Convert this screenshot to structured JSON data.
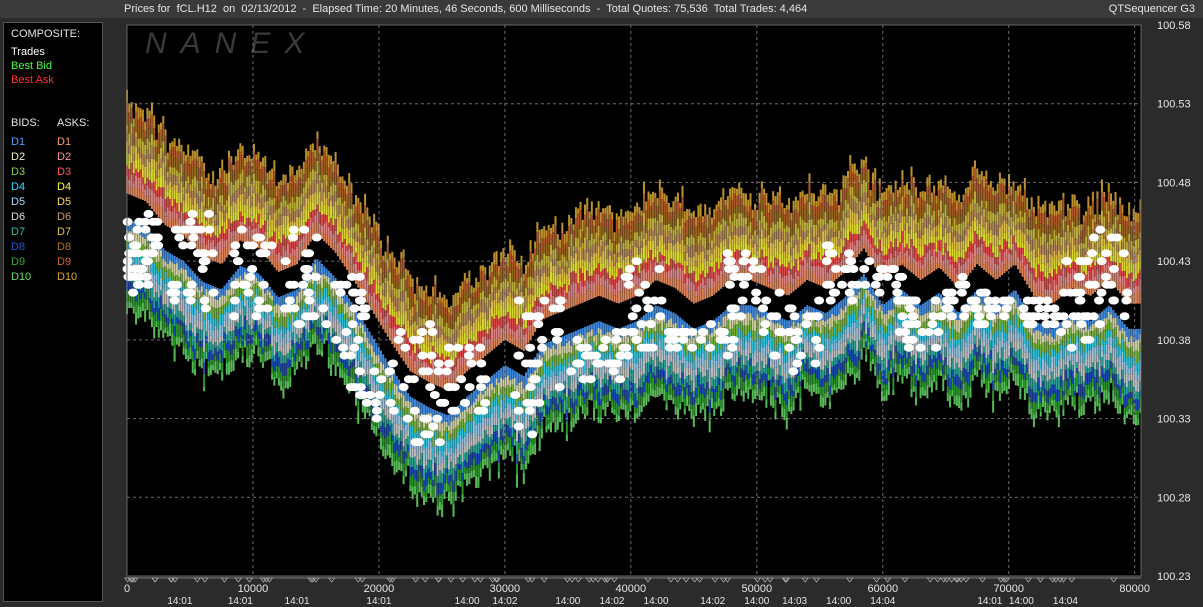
{
  "header": {
    "title": "Prices for  fCL.H12  on  02/13/2012  -  Elapsed Time: 20 Minutes, 46 Seconds, 600 Milliseconds  -  Total Quotes: 75,536  Total Trades: 4,464",
    "app_name": "QTSequencer G3"
  },
  "watermark": "NANEX",
  "legend": {
    "composite_label": "COMPOSITE:",
    "composite_items": [
      {
        "label": "Trades",
        "color": "#ffffff"
      },
      {
        "label": "Best Bid",
        "color": "#44ff44"
      },
      {
        "label": "Best Ask",
        "color": "#ff3333"
      }
    ],
    "bids_label": "BIDS:",
    "asks_label": "ASKS:",
    "bids": [
      {
        "label": "D1",
        "color": "#4a9fff"
      },
      {
        "label": "D2",
        "color": "#f0f0c0"
      },
      {
        "label": "D3",
        "color": "#88cc44"
      },
      {
        "label": "D4",
        "color": "#33e0ff"
      },
      {
        "label": "D5",
        "color": "#aaddff"
      },
      {
        "label": "D6",
        "color": "#dddddd"
      },
      {
        "label": "D7",
        "color": "#33bbaa"
      },
      {
        "label": "D8",
        "color": "#2255cc"
      },
      {
        "label": "D9",
        "color": "#33aa33"
      },
      {
        "label": "D10",
        "color": "#66dd66"
      }
    ],
    "asks": [
      {
        "label": "D1",
        "color": "#ff9966"
      },
      {
        "label": "D2",
        "color": "#ff9999"
      },
      {
        "label": "D3",
        "color": "#ff5555"
      },
      {
        "label": "D4",
        "color": "#ffff33"
      },
      {
        "label": "D5",
        "color": "#ffdd55"
      },
      {
        "label": "D6",
        "color": "#cc9966"
      },
      {
        "label": "D7",
        "color": "#ddcc44"
      },
      {
        "label": "D8",
        "color": "#aa7722"
      },
      {
        "label": "D9",
        "color": "#cc6633"
      },
      {
        "label": "D10",
        "color": "#ddaa33"
      }
    ]
  },
  "chart_data": {
    "type": "scatter",
    "x_range": [
      0,
      80500
    ],
    "y_range": [
      100.23,
      100.58
    ],
    "y_ticks": [
      "100.58",
      "100.53",
      "100.48",
      "100.43",
      "100.38",
      "100.33",
      "100.28",
      "100.23"
    ],
    "x_ticks": [
      "0",
      "10000",
      "20000",
      "30000",
      "40000",
      "50000",
      "60000",
      "70000",
      "80000"
    ],
    "x_time_labels": [
      {
        "x": 4200,
        "label": "14:01"
      },
      {
        "x": 9000,
        "label": "14:01"
      },
      {
        "x": 13500,
        "label": "14:01"
      },
      {
        "x": 20000,
        "label": "14:01"
      },
      {
        "x": 27000,
        "label": "14:00"
      },
      {
        "x": 30000,
        "label": "14:02"
      },
      {
        "x": 35000,
        "label": "14:00"
      },
      {
        "x": 38500,
        "label": "14:02"
      },
      {
        "x": 42000,
        "label": "14:00"
      },
      {
        "x": 46500,
        "label": "14:02"
      },
      {
        "x": 50000,
        "label": "14:00"
      },
      {
        "x": 53000,
        "label": "14:03"
      },
      {
        "x": 56500,
        "label": "14:00"
      },
      {
        "x": 60000,
        "label": "14:04"
      },
      {
        "x": 68500,
        "label": "14:01"
      },
      {
        "x": 71000,
        "label": "14:00"
      },
      {
        "x": 74500,
        "label": "14:04"
      }
    ],
    "grid": "dashed",
    "trade_paths": [
      [
        [
          0,
          100.465
        ],
        [
          1500,
          100.46
        ],
        [
          3000,
          100.445
        ],
        [
          4500,
          100.438
        ],
        [
          6000,
          100.425
        ],
        [
          7500,
          100.42
        ],
        [
          9000,
          100.435
        ],
        [
          10500,
          100.43
        ],
        [
          12000,
          100.415
        ],
        [
          13500,
          100.42
        ],
        [
          15000,
          100.44
        ],
        [
          16500,
          100.428
        ],
        [
          18000,
          100.41
        ],
        [
          19500,
          100.39
        ],
        [
          21000,
          100.37
        ],
        [
          22500,
          100.352
        ],
        [
          24000,
          100.345
        ],
        [
          25500,
          100.34
        ],
        [
          27000,
          100.352
        ],
        [
          28500,
          100.362
        ],
        [
          30000,
          100.372
        ],
        [
          31500,
          100.365
        ],
        [
          33000,
          100.385
        ],
        [
          34500,
          100.39
        ],
        [
          36000,
          100.395
        ],
        [
          37500,
          100.4
        ],
        [
          39000,
          100.395
        ],
        [
          40500,
          100.4
        ],
        [
          42000,
          100.41
        ],
        [
          43500,
          100.405
        ],
        [
          45000,
          100.395
        ],
        [
          46500,
          100.4
        ],
        [
          48000,
          100.41
        ],
        [
          49500,
          100.41
        ],
        [
          51000,
          100.405
        ],
        [
          52500,
          100.4
        ],
        [
          54000,
          100.41
        ],
        [
          55500,
          100.405
        ],
        [
          57000,
          100.415
        ],
        [
          58500,
          100.43
        ],
        [
          60000,
          100.41
        ],
        [
          61500,
          100.42
        ],
        [
          63000,
          100.41
        ],
        [
          64500,
          100.418
        ],
        [
          66000,
          100.405
        ],
        [
          67500,
          100.42
        ],
        [
          69000,
          100.41
        ],
        [
          70500,
          100.42
        ],
        [
          72000,
          100.4
        ],
        [
          73500,
          100.395
        ],
        [
          75000,
          100.405
        ],
        [
          76500,
          100.4
        ],
        [
          78000,
          100.41
        ],
        [
          79500,
          100.395
        ]
      ]
    ],
    "trade_clusters": [
      {
        "x": [
          0,
          2500
        ],
        "y": [
          100.41,
          100.46
        ],
        "n": 40
      },
      {
        "x": [
          3500,
          7000
        ],
        "y": [
          100.4,
          100.46
        ],
        "n": 34
      },
      {
        "x": [
          8500,
          11500
        ],
        "y": [
          100.395,
          100.45
        ],
        "n": 28
      },
      {
        "x": [
          12500,
          16000
        ],
        "y": [
          100.39,
          100.45
        ],
        "n": 30
      },
      {
        "x": [
          16500,
          19000
        ],
        "y": [
          100.37,
          100.42
        ],
        "n": 24
      },
      {
        "x": [
          17000,
          21500
        ],
        "y": [
          100.33,
          100.37
        ],
        "n": 22
      },
      {
        "x": [
          21500,
          25500
        ],
        "y": [
          100.31,
          100.39
        ],
        "n": 34
      },
      {
        "x": [
          25500,
          28500
        ],
        "y": [
          100.33,
          100.38
        ],
        "n": 24
      },
      {
        "x": [
          30500,
          33000
        ],
        "y": [
          100.32,
          100.35
        ],
        "n": 8
      },
      {
        "x": [
          31000,
          34500
        ],
        "y": [
          100.35,
          100.41
        ],
        "n": 28
      },
      {
        "x": [
          35000,
          39500
        ],
        "y": [
          100.355,
          100.39
        ],
        "n": 30
      },
      {
        "x": [
          39500,
          42500
        ],
        "y": [
          100.37,
          100.43
        ],
        "n": 28
      },
      {
        "x": [
          43000,
          48500
        ],
        "y": [
          100.37,
          100.39
        ],
        "n": 34
      },
      {
        "x": [
          47500,
          50500
        ],
        "y": [
          100.39,
          100.44
        ],
        "n": 26
      },
      {
        "x": [
          50500,
          55000
        ],
        "y": [
          100.36,
          100.41
        ],
        "n": 34
      },
      {
        "x": [
          55000,
          58000
        ],
        "y": [
          100.4,
          100.44
        ],
        "n": 22
      },
      {
        "x": [
          58500,
          61000
        ],
        "y": [
          100.41,
          100.43
        ],
        "n": 14
      },
      {
        "x": [
          61000,
          64500
        ],
        "y": [
          100.37,
          100.42
        ],
        "n": 34
      },
      {
        "x": [
          64500,
          68500
        ],
        "y": [
          100.39,
          100.42
        ],
        "n": 28
      },
      {
        "x": [
          67000,
          70500
        ],
        "y": [
          100.395,
          100.41
        ],
        "n": 18
      },
      {
        "x": [
          70500,
          74000
        ],
        "y": [
          100.39,
          100.41
        ],
        "n": 24
      },
      {
        "x": [
          74000,
          76500
        ],
        "y": [
          100.375,
          100.43
        ],
        "n": 22
      },
      {
        "x": [
          76000,
          79500
        ],
        "y": [
          100.39,
          100.45
        ],
        "n": 26
      }
    ],
    "depth_bands": {
      "ask_colors": [
        "#ff9966",
        "#ff9999",
        "#ff5555",
        "#ffff33",
        "#ffdd55",
        "#cc9966",
        "#ddcc44",
        "#aa7722",
        "#cc6633",
        "#ddaa33"
      ],
      "bid_colors": [
        "#4a9fff",
        "#f0f0c0",
        "#88cc44",
        "#33e0ff",
        "#aaddff",
        "#dddddd",
        "#33bbaa",
        "#2255cc",
        "#33aa33",
        "#66dd66"
      ]
    }
  }
}
